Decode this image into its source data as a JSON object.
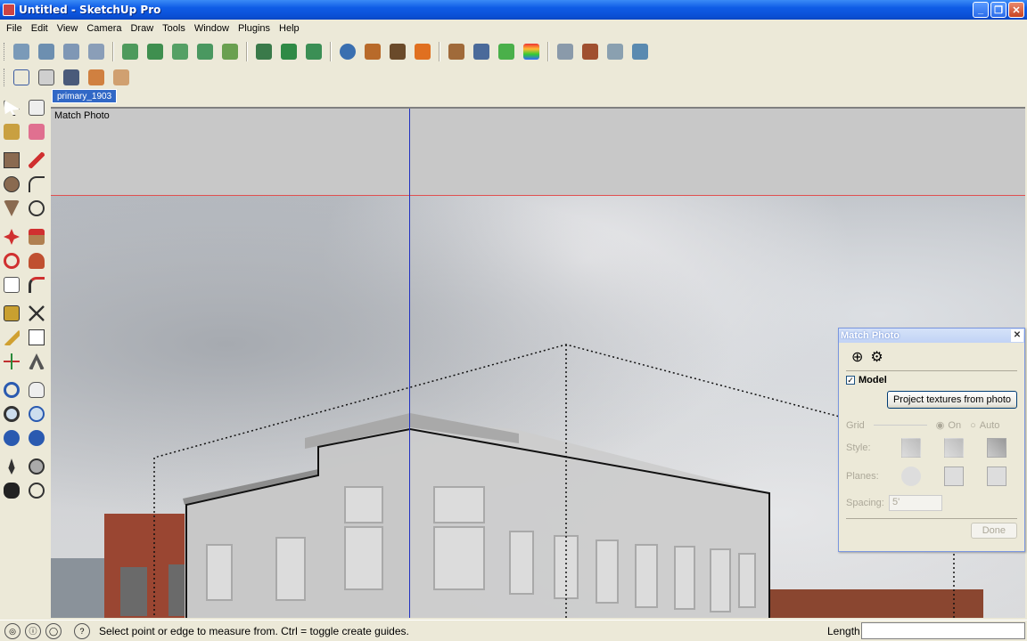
{
  "window": {
    "title": "Untitled - SketchUp Pro"
  },
  "menu": [
    "File",
    "Edit",
    "View",
    "Camera",
    "Draw",
    "Tools",
    "Window",
    "Plugins",
    "Help"
  ],
  "toolbars": {
    "row1": [
      "new",
      "open",
      "save",
      "cut",
      "components",
      "groups",
      "terrain",
      "add-detail",
      "sandbox",
      "flip",
      "push-pull",
      "move",
      "zoom-extents",
      "filter",
      "select",
      "warning",
      "iso",
      "front",
      "top",
      "xray",
      "shaded",
      "front-view",
      "left-view",
      "right-view",
      "back-view"
    ],
    "row2": [
      "wireframe",
      "hidden-line",
      "shaded-texture",
      "layers",
      "scenes"
    ]
  },
  "scene_tab": "primary_1903",
  "viewport": {
    "label": "Match Photo"
  },
  "left_tools": [
    "select",
    "eraser",
    "paint",
    "make-component",
    "rectangle",
    "line",
    "circle",
    "arc",
    "polygon",
    "freehand",
    "move",
    "push-pull",
    "rotate",
    "follow-me",
    "scale",
    "offset",
    "tape-measure",
    "dimension",
    "protractor",
    "text",
    "axes",
    "3d-text",
    "orbit",
    "pan",
    "zoom",
    "zoom-window",
    "previous",
    "zoom-extents",
    "position-camera",
    "look-around",
    "walk",
    "section-plane"
  ],
  "match_photo": {
    "title": "Match Photo",
    "model_label": "Model",
    "model_checked": true,
    "project_button": "Project textures from photo",
    "grid_label": "Grid",
    "on_label": "On",
    "auto_label": "Auto",
    "style_label": "Style:",
    "planes_label": "Planes:",
    "spacing_label": "Spacing:",
    "spacing_value": "5'",
    "done_button": "Done"
  },
  "status": {
    "text": "Select point or edge to measure from.  Ctrl = toggle create guides.",
    "length_label": "Length",
    "length_value": ""
  }
}
